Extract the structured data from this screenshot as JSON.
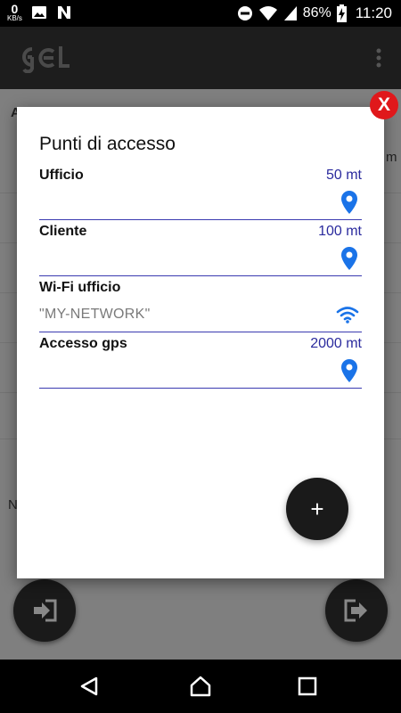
{
  "status_bar": {
    "data_rate_value": "0",
    "data_rate_unit": "KB/s",
    "battery": "86%",
    "time": "11:20"
  },
  "app": {
    "name": "gel"
  },
  "background": {
    "header_text": "A",
    "side_text": "m",
    "bottom_text": "N"
  },
  "dialog": {
    "title": "Punti di accesso",
    "close_label": "X",
    "rows": [
      {
        "label": "Ufficio",
        "value": "50 mt",
        "icon": "location-pin-icon"
      },
      {
        "label": "Cliente",
        "value": "100 mt",
        "icon": "location-pin-icon"
      },
      {
        "label": "Wi-Fi ufficio",
        "placeholder": "\"MY-NETWORK\"",
        "icon": "wifi-icon"
      },
      {
        "label": "Accesso gps",
        "value": "2000 mt",
        "icon": "location-pin-icon"
      }
    ],
    "fab_label": "+"
  },
  "colors": {
    "accent": "#1a73e8",
    "value_text": "#2b2b9e",
    "divider": "#3a3ab0",
    "close": "#e0181b"
  }
}
